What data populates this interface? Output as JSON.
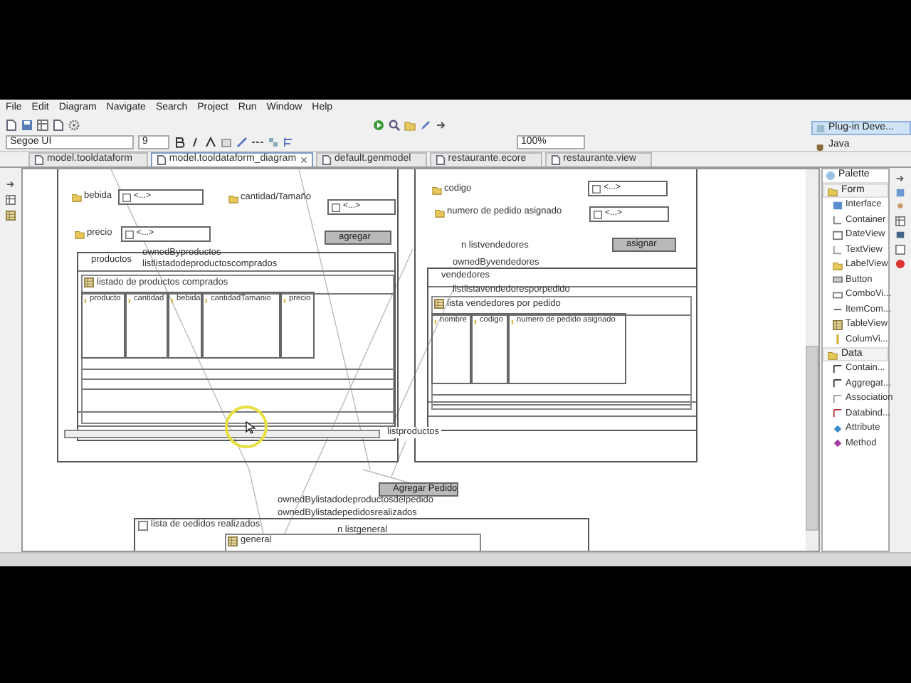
{
  "menu": [
    "File",
    "Edit",
    "Diagram",
    "Navigate",
    "Search",
    "Project",
    "Run",
    "Window",
    "Help"
  ],
  "toolbar": {
    "font": "Segoe UI",
    "size": "9",
    "zoom": "100%"
  },
  "perspectives": [
    {
      "label": "Plug-in Deve...",
      "selected": true
    },
    {
      "label": "Java",
      "selected": false
    }
  ],
  "tabs": [
    {
      "label": "model.tooldataform",
      "selected": false
    },
    {
      "label": "model.tooldataform_diagram",
      "selected": true
    },
    {
      "label": "default.genmodel",
      "selected": false
    },
    {
      "label": "restaurante.ecore",
      "selected": false
    },
    {
      "label": "restaurante.view",
      "selected": false
    }
  ],
  "diagram": {
    "forms": [
      {
        "attributes": [
          {
            "label": "bebida",
            "value": "<...>"
          },
          {
            "label": "cantidad/Tamaño",
            "value": "<...>"
          },
          {
            "label": "precio",
            "value": "<...>"
          }
        ],
        "button": "agregar",
        "container": {
          "title": "productos",
          "owner": "ownedByproductos",
          "list": "listlistadodeproductoscomprados",
          "table": {
            "title": "listado de productos comprados",
            "columns": [
              "producto",
              "cantidad",
              "bebida",
              "cantidadTamanio",
              "precio"
            ]
          }
        },
        "link": "listproductos"
      },
      {
        "attributes": [
          {
            "label": "codigo",
            "value": "<...>"
          },
          {
            "label": "numero de pedido asignado",
            "value": "<...>"
          }
        ],
        "link": "n listvendedores",
        "button": "asignar",
        "container": {
          "title": "vendedores",
          "owner": "ownedByvendedores",
          "list": "listlistavendedoresporpedido",
          "table": {
            "title": "lista vendedores por pedido",
            "columns": [
              "nombre",
              "codigo",
              "numero de pedido asignado"
            ]
          }
        }
      }
    ],
    "action_button": "Agregar Pedido",
    "relations": [
      "ownedBylistadodeproductosdelpedido",
      "ownedBylistadepedidosrealizados",
      "n listgeneral"
    ],
    "orders": {
      "title": "lista de oedidos realizados",
      "table": "general"
    }
  },
  "palette": {
    "title": "Palette",
    "sections": [
      {
        "title": "Form",
        "expanded": true,
        "items": [
          "Interface",
          "Container",
          "DateView",
          "TextView",
          "LabelView",
          "Button",
          "ComboVi...",
          "ItemCom...",
          "TableView",
          "ColumVi..."
        ]
      },
      {
        "title": "Data",
        "expanded": true,
        "items": [
          "Contain...",
          "Aggregat...",
          "Association",
          "Databind...",
          "Attribute",
          "Method"
        ]
      }
    ]
  }
}
